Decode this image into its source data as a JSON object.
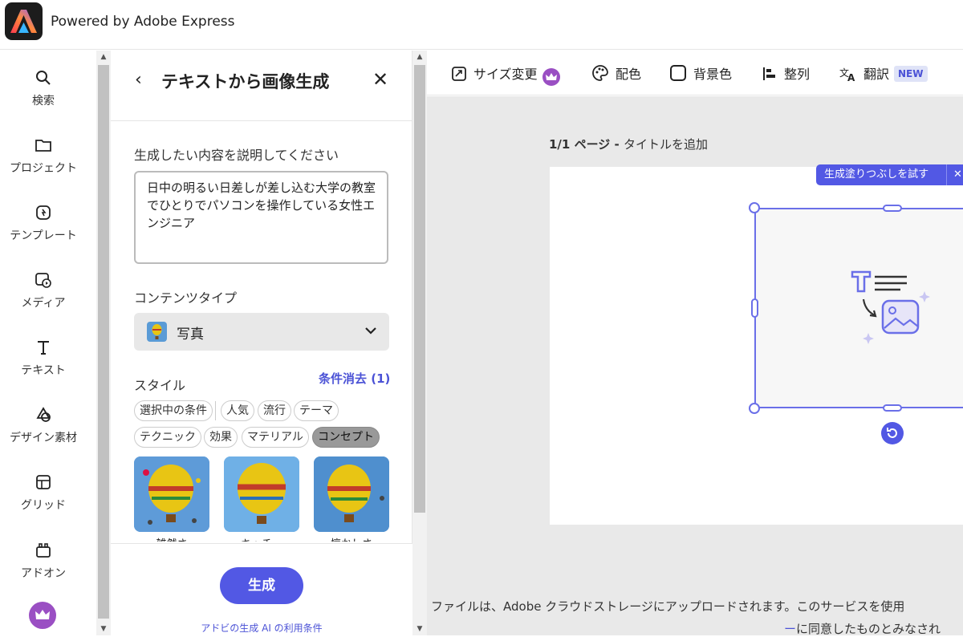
{
  "app": {
    "brand": "Powered by Adobe Express"
  },
  "rail": {
    "items": [
      {
        "label": "検索",
        "icon": "search-icon"
      },
      {
        "label": "プロジェクト",
        "icon": "folder-icon"
      },
      {
        "label": "テンプレート",
        "icon": "template-icon"
      },
      {
        "label": "メディア",
        "icon": "media-icon"
      },
      {
        "label": "テキスト",
        "icon": "text-icon"
      },
      {
        "label": "デザイン素材",
        "icon": "shapes-icon"
      },
      {
        "label": "グリッド",
        "icon": "grid-icon"
      },
      {
        "label": "アドオン",
        "icon": "addon-icon"
      }
    ]
  },
  "panel": {
    "title": "テキストから画像生成",
    "prompt_label": "生成したい内容を説明してください",
    "prompt_value": "日中の明るい日差しが差し込む大学の教室でひとりでパソコンを操作している女性エンジニア",
    "content_type_label": "コンテンツタイプ",
    "content_type_value": "写真",
    "style_label": "スタイル",
    "reset_label": "条件消去 (1)",
    "chips": [
      "選択中の条件",
      "人気",
      "流行",
      "テーマ",
      "テクニック",
      "効果",
      "マテリアル",
      "コンセプト"
    ],
    "style_thumbs": [
      "雑然さ",
      "キッチュ",
      "懐かしさ"
    ],
    "generate_label": "生成",
    "terms_label": "アドビの生成 AI の利用条件"
  },
  "toolbar": {
    "resize": "サイズ変更",
    "color": "配色",
    "background": "背景色",
    "align": "整列",
    "translate": "翻訳",
    "new_badge": "NEW"
  },
  "canvas": {
    "page_prefix": "1/1 ページ - ",
    "page_title_placeholder": "タイトルを追加",
    "gen_fill": "生成塗りつぶしを試す",
    "footer_line1": "ファイルは、Adobe クラウドストレージにアップロードされます。このサービスを使用",
    "footer_line2_link": "ー",
    "footer_line2_rest": "に同意したものとみなされ"
  },
  "colors": {
    "accent": "#5258e4",
    "premium": "#9a4fc3"
  }
}
